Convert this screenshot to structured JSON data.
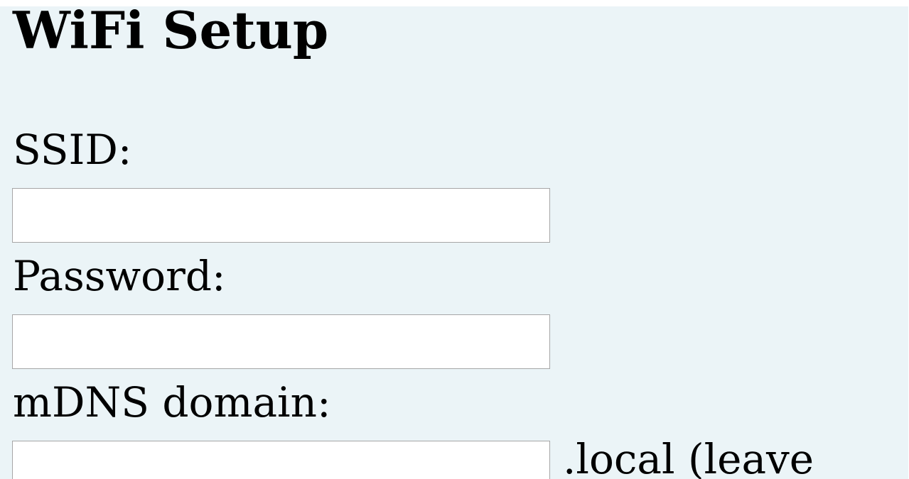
{
  "page": {
    "title": "WiFi Setup",
    "background_color": "#ebf4f7"
  },
  "form": {
    "ssid": {
      "label": "SSID:",
      "value": "",
      "placeholder": ""
    },
    "password": {
      "label": "Password:",
      "value": "",
      "placeholder": ""
    },
    "mdns": {
      "label": "mDNS domain:",
      "value": "",
      "placeholder": "",
      "suffix": ".local (leave"
    }
  }
}
